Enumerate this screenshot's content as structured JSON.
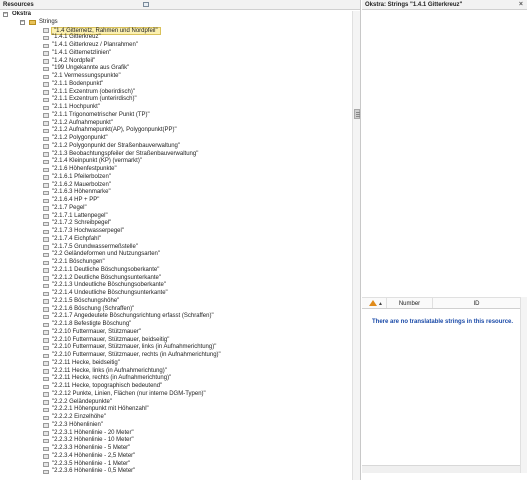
{
  "left_pane": {
    "title": "Resources"
  },
  "tree": {
    "root": "Okstra",
    "folder": "Strings",
    "items": [
      "\"1.4 Gitternetz, Rahmen und Nordpfeil\"",
      "\"1.4.1 Gitterkreuz\"",
      "\"1.4.1 Gitterkreuz / Planrahmen\"",
      "\"1.4.1 Gitternetzlinien\"",
      "\"1.4.2 Nordpfeil\"",
      "\"199 Ungekannte aus Grafik\"",
      "\"2.1 Vermessungspunkte\"",
      "\"2.1.1 Bodenpunkt\"",
      "\"2.1.1 Exzentrum (oberirdisch)\"",
      "\"2.1.1 Exzentrum (unterirdisch)\"",
      "\"2.1.1 Hochpunkt\"",
      "\"2.1.1 Trigonometrischer Punkt (TP)\"",
      "\"2.1.2 Aufnahmepunkt\"",
      "\"2.1.2 Aufnahmepunkt(AP), Polygonpunkt(PP)\"",
      "\"2.1.2 Polygonpunkt\"",
      "\"2.1.2 Polygonpunkt der Straßenbauverwaltung\"",
      "\"2.1.3 Beobachtungspfeiler der Straßenbauverwaltung\"",
      "\"2.1.4 Kleinpunkt (KP) (vermarkt)\"",
      "\"2.1.6 Höhenfestpunkte\"",
      "\"2.1.6.1 Pfeilerbolzen\"",
      "\"2.1.6.2 Mauerbolzen\"",
      "\"2.1.6.3 Höhenmarke\"",
      "\"2.1.6.4 HP + PP\"",
      "\"2.1.7 Pegel\"",
      "\"2.1.7.1 Lattenpegel\"",
      "\"2.1.7.2 Schreibpegel\"",
      "\"2.1.7.3 Hochwasserpegel\"",
      "\"2.1.7.4 Eichpfahl\"",
      "\"2.1.7.5 Grundwassermeßstelle\"",
      "\"2.2 Geländeformen und Nutzungsarten\"",
      "\"2.2.1 Böschungen\"",
      "\"2.2.1.1 Deutliche Böschungsoberkante\"",
      "\"2.2.1.2 Deutliche Böschungsunterkante\"",
      "\"2.2.1.3 Undeutliche Böschungsoberkante\"",
      "\"2.2.1.4 Undeutliche Böschungsunterkante\"",
      "\"2.2.1.5 Böschungshöhe\"",
      "\"2.2.1.6 Böschung (Schraffen)\"",
      "\"2.2.1.7 Angedeutete Böschungsrichtung erfasst (Schraffen)\"",
      "\"2.2.1.8 Befestigte Böschung\"",
      "\"2.2.10 Futtermauer, Stützmauer\"",
      "\"2.2.10 Futtermauer, Stützmauer, beidseitig\"",
      "\"2.2.10 Futtermauer, Stützmauer, links (in Aufnahmerichtung)\"",
      "\"2.2.10 Futtermauer, Stützmauer, rechts (in Aufnahmerichtung)\"",
      "\"2.2.11 Hecke, beidseitig\"",
      "\"2.2.11 Hecke, links (in Aufnahmerichtung)\"",
      "\"2.2.11 Hecke, rechts (in Aufnahmerichtung)\"",
      "\"2.2.11 Hecke, topographisch bedeutend\"",
      "\"2.2.12 Punkte, Linien, Flächen (nur interne DGM-Typen)\"",
      "\"2.2.2 Geländepunkte\"",
      "\"2.2.2.1 Höhenpunkt mit Höhenzahl\"",
      "\"2.2.2.2 Einzelhöhe\"",
      "\"2.2.3 Höhenlinien\"",
      "\"2.2.3.1 Höhenlinie - 20 Meter\"",
      "\"2.2.3.2 Höhenlinie - 10 Meter\"",
      "\"2.2.3.3 Höhenlinie - 5 Meter\"",
      "\"2.2.3.4 Höhenlinie - 2,5 Meter\"",
      "\"2.2.3.5 Höhenlinie - 1 Meter\"",
      "\"2.2.3.6 Höhenlinie - 0,5 Meter\""
    ]
  },
  "right_pane": {
    "title": "Okstra: Strings \"1.4.1 Gitterkreuz\"",
    "close": "×",
    "columns": {
      "number": "Number",
      "id": "ID"
    },
    "sort_marker": "▲",
    "empty_message": "There are no translatable strings in this resource."
  },
  "colors": {
    "message": "#1a4aa8",
    "selection": "#fbf0b0",
    "warning": "#e08b1b"
  }
}
